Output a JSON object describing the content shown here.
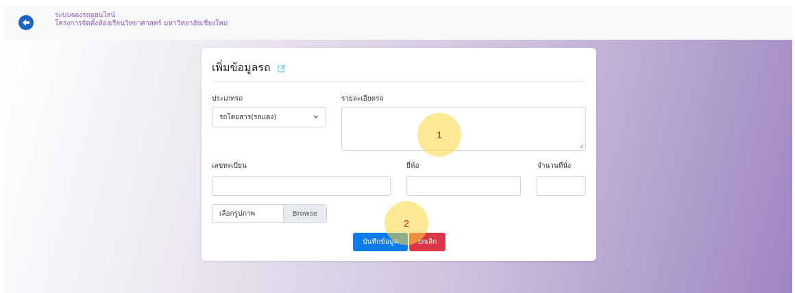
{
  "header": {
    "title_line1": "ระบบจองรถออนไลน์",
    "title_line2": "โครงการจัดตั้งห้องเรียนวิทยาศาสตร์ มหาวิทยาลัยเชียงใหม่",
    "back_icon": "arrow-left-circle-icon"
  },
  "form": {
    "title": "เพิ่มข้อมูลรถ",
    "title_icon": "edit-icon",
    "vehicle_type": {
      "label": "ประเภทรถ",
      "value": "รถโดยสาร(รถแดง)"
    },
    "vehicle_details": {
      "label": "รายละเอียดรถ",
      "value": ""
    },
    "license_plate": {
      "label": "เลขทะเบียน",
      "value": ""
    },
    "brand": {
      "label": "ยี่ห้อ",
      "value": ""
    },
    "seat_count": {
      "label": "จำนวนที่นั่ง",
      "value": ""
    },
    "image_upload": {
      "label": "เลือกรูปภาพ",
      "browse": "Browse"
    },
    "save_button": "บันทึกข้อมูล",
    "cancel_button": "ยกเลิก"
  },
  "annotations": {
    "marker1": "1",
    "marker2": "2"
  },
  "colors": {
    "brand_text": "#8c5bb8",
    "primary": "#0d7bf0",
    "danger": "#dc3545",
    "back_button": "#1e63c4",
    "marker_fill": "#fcd73c",
    "marker_text": "#c8102e"
  }
}
